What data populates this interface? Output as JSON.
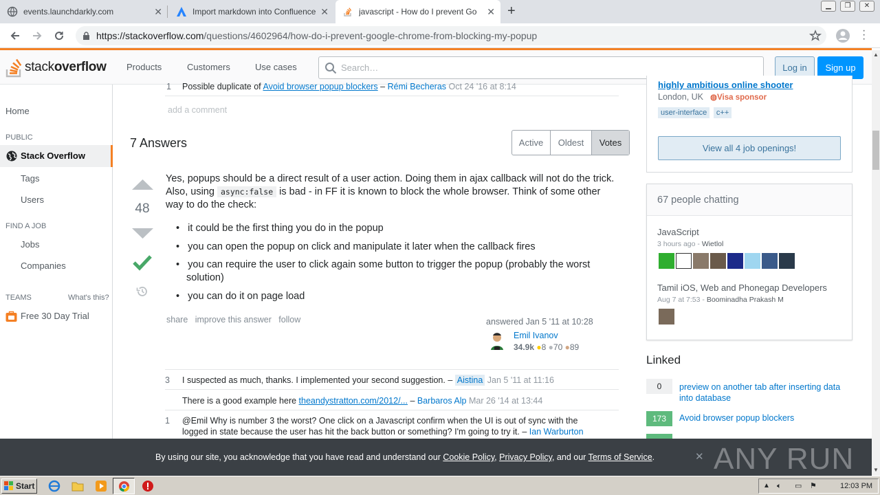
{
  "browser": {
    "tabs": [
      {
        "title": "events.launchdarkly.com"
      },
      {
        "title": "Import markdown into Confluence"
      },
      {
        "title": "javascript - How do I prevent Google"
      }
    ],
    "new_tab": "+",
    "url_domain": "https://stackoverflow.com",
    "url_path": "/questions/4602964/how-do-i-prevent-google-chrome-from-blocking-my-popup"
  },
  "header": {
    "logo_stack": "stack",
    "logo_overflow": "overflow",
    "nav": [
      "Products",
      "Customers",
      "Use cases"
    ],
    "search_placeholder": "Search…",
    "login": "Log in",
    "signup": "Sign up"
  },
  "sidebar": {
    "home": "Home",
    "public": "PUBLIC",
    "stackoverflow": "Stack Overflow",
    "tags": "Tags",
    "users": "Users",
    "find_job": "FIND A JOB",
    "jobs": "Jobs",
    "companies": "Companies",
    "teams": "TEAMS",
    "whats_this": "What's this?",
    "trial": "Free 30 Day Trial"
  },
  "question_comment": {
    "score": "1",
    "text": "Possible duplicate of ",
    "link": "Avoid browser popup blockers",
    "dash": " – ",
    "user": "Rémi Becheras",
    "date": "Oct 24 '16 at 8:14"
  },
  "add_comment": "add a comment",
  "answers": {
    "count_title": "7 Answers",
    "sort": [
      "Active",
      "Oldest",
      "Votes"
    ]
  },
  "answer": {
    "votes": "48",
    "p1": "Yes, popups should be a direct result of a user action. Doing them in ajax callback will not do the trick.",
    "p2a": "Also, using ",
    "code": "async:false",
    "p2b": " is bad - in FF it is known to block the whole browser. Think of some other",
    "p3": "way to do the check:",
    "bullets": [
      "it could be the first thing you do in the popup",
      "you can open the popup on click and manipulate it later when the callback fires",
      "you can require the user to click again some button to trigger the popup (probably the worst",
      "solution)",
      "you can do it on page load"
    ],
    "actions": [
      "share",
      "improve this answer",
      "follow"
    ],
    "answered": "answered Jan 5 '11 at 10:28",
    "author": "Emil Ivanov",
    "rep": "34.9k",
    "gold": "8",
    "silver": "70",
    "bronze": "89"
  },
  "comments": [
    {
      "score": "3",
      "text": "I suspected as much, thanks. I implemented your second suggestion. –",
      "user": "Aistina",
      "date": "Jan 5 '11 at 11:16"
    },
    {
      "score": "",
      "text": "There is a good example here ",
      "link": "theandystratton.com/2012/...",
      "user": "Barbaros Alp",
      "date": "Mar 26 '14 at 13:44"
    },
    {
      "score": "1",
      "text": "@Emil Why is number 3 the worst? One click on a Javascript confirm when the UI is out of sync with the",
      "text2": "logged in state because the user has hit the back button or something? I'm going to try it. –",
      "user": "Ian Warburton"
    }
  ],
  "right": {
    "job_title": "highly ambitious online shooter",
    "job_location": "London, UK",
    "visa": "Visa sponsor",
    "job_tags": [
      "user-interface",
      "c++"
    ],
    "view_jobs": "View all 4 job openings!",
    "chat_header": "67 people chatting",
    "rooms": [
      {
        "name": "JavaScript",
        "time": "3 hours ago",
        "user": "Wietlol"
      },
      {
        "name": "Tamil iOS, Web and Phonegap Developers",
        "time": "Aug 7 at 7:53",
        "user": "Boominadha Prakash M"
      }
    ],
    "linked_title": "Linked",
    "linked": [
      {
        "count": "0",
        "title": "preview on another tab after inserting data",
        "title2": "into database"
      },
      {
        "count": "173",
        "title": "Avoid browser popup blockers"
      }
    ]
  },
  "cookie": {
    "text1": "By using our site, you acknowledge that you have read and understand our ",
    "cookie_policy": "Cookie Policy",
    "comma": ", ",
    "privacy": "Privacy Policy",
    "and": ", and our ",
    "tos": "Terms of Service",
    "dot": ".",
    "close": "✕"
  },
  "watermark": "ANY RUN",
  "taskbar": {
    "start": "Start",
    "time": "12:03 PM"
  },
  "colors": {
    "so_orange": "#f48024",
    "blue": "#0095ff",
    "accept_green": "#48a868",
    "linked_green": "#5eba7d"
  }
}
